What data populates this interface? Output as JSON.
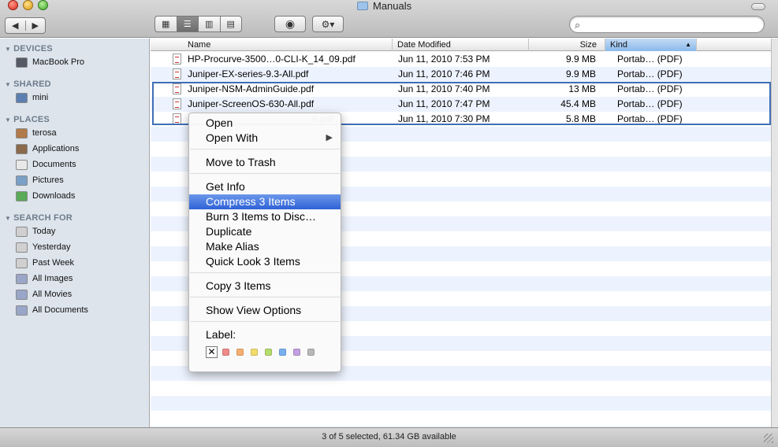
{
  "window": {
    "title": "Manuals",
    "nav": {
      "back": "◀",
      "forward": "▶"
    },
    "views": [
      "▦",
      "☰",
      "▥",
      "▤"
    ],
    "active_view": 1,
    "eye_glyph": "◉",
    "action_glyph": "⚙▾"
  },
  "search": {
    "value": "",
    "placeholder": ""
  },
  "sidebar": {
    "sections": [
      {
        "title": "DEVICES",
        "items": [
          {
            "label": "MacBook Pro",
            "icon": "laptop-icon",
            "color": "#555a66"
          }
        ]
      },
      {
        "title": "SHARED",
        "items": [
          {
            "label": "mini",
            "icon": "display-icon",
            "color": "#5b7fb0"
          }
        ]
      },
      {
        "title": "PLACES",
        "items": [
          {
            "label": "terosa",
            "icon": "home-icon",
            "color": "#b07a4a"
          },
          {
            "label": "Applications",
            "icon": "applications-icon",
            "color": "#8a6a4a"
          },
          {
            "label": "Documents",
            "icon": "documents-icon",
            "color": "#e8e8e8"
          },
          {
            "label": "Pictures",
            "icon": "pictures-icon",
            "color": "#7aa0c8"
          },
          {
            "label": "Downloads",
            "icon": "downloads-icon",
            "color": "#5aaa5a"
          }
        ]
      },
      {
        "title": "SEARCH FOR",
        "items": [
          {
            "label": "Today",
            "icon": "clock-icon",
            "color": "#d0d0d0"
          },
          {
            "label": "Yesterday",
            "icon": "clock-icon",
            "color": "#d0d0d0"
          },
          {
            "label": "Past Week",
            "icon": "clock-icon",
            "color": "#d0d0d0"
          },
          {
            "label": "All Images",
            "icon": "smart-folder-icon",
            "color": "#9aa6c8"
          },
          {
            "label": "All Movies",
            "icon": "smart-folder-icon",
            "color": "#9aa6c8"
          },
          {
            "label": "All Documents",
            "icon": "smart-folder-icon",
            "color": "#9aa6c8"
          }
        ]
      }
    ]
  },
  "list": {
    "columns": [
      "Name",
      "Date Modified",
      "Size",
      "Kind"
    ],
    "sort_column": "Kind",
    "sort_glyph": "▲",
    "rows": [
      {
        "name": "HP-Procurve-3500…0-CLI-K_14_09.pdf",
        "date": "Jun 11, 2010 7:53 PM",
        "size": "9.9 MB",
        "kind": "Portab… (PDF)"
      },
      {
        "name": "Juniper-EX-series-9.3-All.pdf",
        "date": "Jun 11, 2010 7:46 PM",
        "size": "9.9 MB",
        "kind": "Portab… (PDF)"
      },
      {
        "name": "Juniper-NSM-AdminGuide.pdf",
        "date": "Jun 11, 2010 7:40 PM",
        "size": "13 MB",
        "kind": "Portab… (PDF)"
      },
      {
        "name": "Juniper-ScreenOS-630-All.pdf",
        "date": "Jun 11, 2010 7:47 PM",
        "size": "45.4 MB",
        "kind": "Portab… (PDF)"
      },
      {
        "name": "e.pdf",
        "date": "Jun 11, 2010 7:30 PM",
        "size": "5.8 MB",
        "kind": "Portab… (PDF)"
      }
    ]
  },
  "context_menu": {
    "items": [
      {
        "label": "Open",
        "has_submenu": false
      },
      {
        "label": "Open With",
        "has_submenu": true,
        "submenu_glyph": "▶"
      },
      {
        "label": "Move to Trash",
        "has_submenu": false
      },
      {
        "label": "Get Info",
        "has_submenu": false
      },
      {
        "label": "Compress 3 Items",
        "has_submenu": false,
        "highlighted": true
      },
      {
        "label": "Burn 3 Items to Disc…",
        "has_submenu": false
      },
      {
        "label": "Duplicate",
        "has_submenu": false
      },
      {
        "label": "Make Alias",
        "has_submenu": false
      },
      {
        "label": "Quick Look 3 Items",
        "has_submenu": false
      },
      {
        "label": "Copy 3 Items",
        "has_submenu": false
      },
      {
        "label": "Show View Options",
        "has_submenu": false
      }
    ],
    "label_title": "Label:",
    "label_none_glyph": "✕",
    "label_colors": [
      "#f08a8a",
      "#f5b070",
      "#f2dc6a",
      "#b6dc6e",
      "#78b0f0",
      "#c2a0e0",
      "#b8b8b8"
    ]
  },
  "status": {
    "text": "3 of 5 selected, 61.34 GB available"
  }
}
